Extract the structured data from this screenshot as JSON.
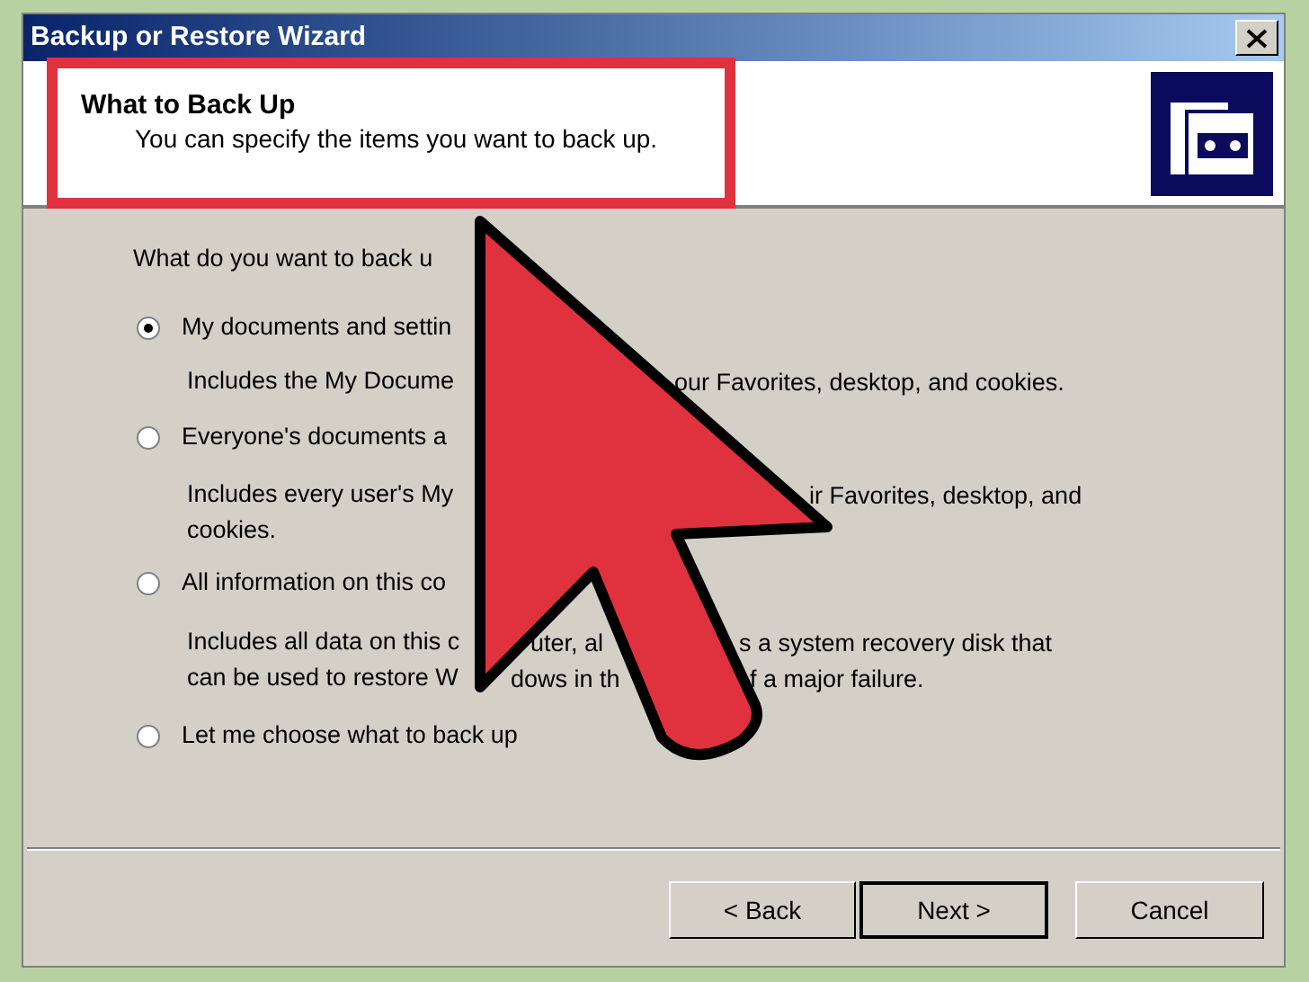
{
  "window": {
    "title": "Backup or Restore Wizard"
  },
  "header": {
    "title": "What to Back Up",
    "subtitle": "You can specify the items you want to back up."
  },
  "prompt": "What do you want to back u",
  "options": [
    {
      "label": "My documents and settin",
      "selected": true,
      "description": [
        [
          "Includes the My Docume",
          "our Favorites, desktop, and cookies."
        ]
      ]
    },
    {
      "label": "Everyone's documents a",
      "selected": false,
      "description": [
        [
          "Includes every user's My",
          "ir Favorites, desktop, and"
        ],
        [
          "cookies."
        ]
      ]
    },
    {
      "label": "All information on this co",
      "selected": false,
      "description": [
        [
          "Includes all data on this c",
          "uter, al",
          "s a system recovery disk that"
        ],
        [
          "can be used to restore W",
          "dows in th",
          "f a major failure."
        ]
      ]
    },
    {
      "label": "Let me choose what to back up",
      "selected": false
    }
  ],
  "buttons": [
    {
      "label": "< Back",
      "default": false
    },
    {
      "label": "Next >",
      "default": true
    },
    {
      "label": "Cancel",
      "default": false
    }
  ]
}
